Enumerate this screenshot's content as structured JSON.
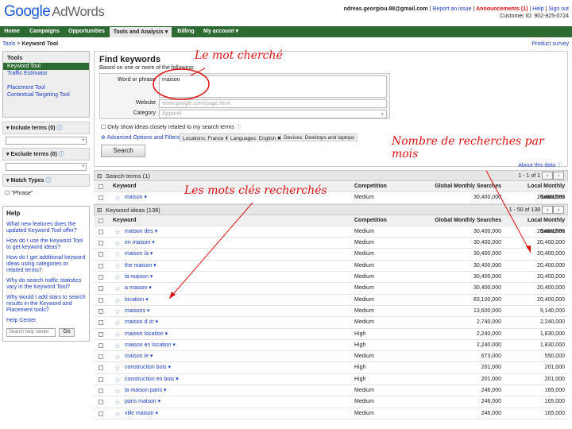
{
  "header": {
    "logo_google": "Google",
    "logo_product": "AdWords",
    "email": "ndreas.georgiou.88@gmail.com",
    "report": "Report an issue",
    "announcements": "Announcements (1)",
    "help": "Help",
    "signout": "Sign out",
    "customer_id": "Customer ID: 902-925-0724"
  },
  "nav": {
    "tabs": [
      "Home",
      "Campaigns",
      "Opportunities",
      "Tools and Analysis ▾",
      "Billing",
      "My account ▾"
    ]
  },
  "breadcrumb": {
    "parent": "Tools",
    "current": "Keyword Tool"
  },
  "product_survey": "Product survey",
  "tools": {
    "title": "Tools",
    "items": [
      "Keyword Tool",
      "Traffic Estimator",
      "Placement Tool",
      "Contextual Targeting Tool"
    ]
  },
  "filters": {
    "include": "Include terms (0)",
    "exclude": "Exclude terms (0)",
    "match": "Match Types",
    "phrase": "\"Phrase\""
  },
  "help": {
    "title": "Help",
    "q1": "What new features does the updated Keyword Tool offer?",
    "q2": "How do I use the Keyword Tool to get keyword ideas?",
    "q3": "How do I get additional keyword ideas using categories or related terms?",
    "q4": "Why do search traffic statistics vary in the Keyword Tool?",
    "q5": "Why would I add stars to search results in the Keyword and Placement tools?",
    "center": "Help Center",
    "placeholder": "Search help center",
    "go": "Go"
  },
  "find": {
    "title": "Find keywords",
    "subtitle": "Based on one or more of the following:",
    "word_label": "Word or phrase",
    "word_value": "maison",
    "website_label": "Website",
    "website_placeholder": "www.google.com/page.html",
    "category_label": "Category",
    "category_placeholder": "Apparel",
    "option": "Only show ideas closely related to my search terms",
    "advanced": "Advanced Options and Filters",
    "loc": "Locations: France ✖",
    "lang": "Languages: English ✖",
    "dev": "Devices: Desktops and laptops",
    "search": "Search",
    "about": "About this data"
  },
  "search_terms": {
    "title": "Search terms (1)",
    "pager": "1 - 1 of 1",
    "rows": [
      {
        "kw": "maison ▾",
        "comp": "Medium",
        "global": "30,400,000",
        "local": "20,400,000"
      }
    ]
  },
  "columns": {
    "keyword": "Keyword",
    "competition": "Competition",
    "global": "Global Monthly Searches",
    "local": "Local Monthly Searches"
  },
  "keyword_ideas": {
    "title": "Keyword ideas (138)",
    "pager": "1 - 50 of 138",
    "rows": [
      {
        "kw": "maison des ▾",
        "comp": "Medium",
        "global": "30,400,000",
        "local": "20,400,000"
      },
      {
        "kw": "en maison ▾",
        "comp": "Medium",
        "global": "30,400,000",
        "local": "20,400,000"
      },
      {
        "kw": "maison la ▾",
        "comp": "Medium",
        "global": "30,400,000",
        "local": "20,400,000"
      },
      {
        "kw": "the maison ▾",
        "comp": "Medium",
        "global": "30,400,000",
        "local": "20,400,000"
      },
      {
        "kw": "la maison ▾",
        "comp": "Medium",
        "global": "30,400,000",
        "local": "20,400,000"
      },
      {
        "kw": "a maison ▾",
        "comp": "Medium",
        "global": "30,400,000",
        "local": "20,400,000"
      },
      {
        "kw": "location ▾",
        "comp": "Medium",
        "global": "83,100,000",
        "local": "20,400,000"
      },
      {
        "kw": "maisons ▾",
        "comp": "Medium",
        "global": "13,600,000",
        "local": "9,140,000"
      },
      {
        "kw": "maison d or ▾",
        "comp": "Medium",
        "global": "2,740,000",
        "local": "2,240,000"
      },
      {
        "kw": "maison location ▾",
        "comp": "High",
        "global": "2,240,000",
        "local": "1,830,000"
      },
      {
        "kw": "maison en location ▾",
        "comp": "High",
        "global": "2,240,000",
        "local": "1,830,000"
      },
      {
        "kw": "maison le ▾",
        "comp": "Medium",
        "global": "673,000",
        "local": "550,000"
      },
      {
        "kw": "construction bois ▾",
        "comp": "High",
        "global": "201,000",
        "local": "201,000"
      },
      {
        "kw": "construction en bois ▾",
        "comp": "High",
        "global": "201,000",
        "local": "201,000"
      },
      {
        "kw": "la maison paris ▾",
        "comp": "Medium",
        "global": "246,000",
        "local": "165,000"
      },
      {
        "kw": "paris maison ▾",
        "comp": "Medium",
        "global": "246,000",
        "local": "165,000"
      },
      {
        "kw": "ville maison ▾",
        "comp": "Medium",
        "global": "246,000",
        "local": "165,000"
      }
    ]
  },
  "annotations": {
    "a1": "Le mot cherché",
    "a2": "Nombre de recherches par mois",
    "a3": "Les mots clés recherchés"
  }
}
